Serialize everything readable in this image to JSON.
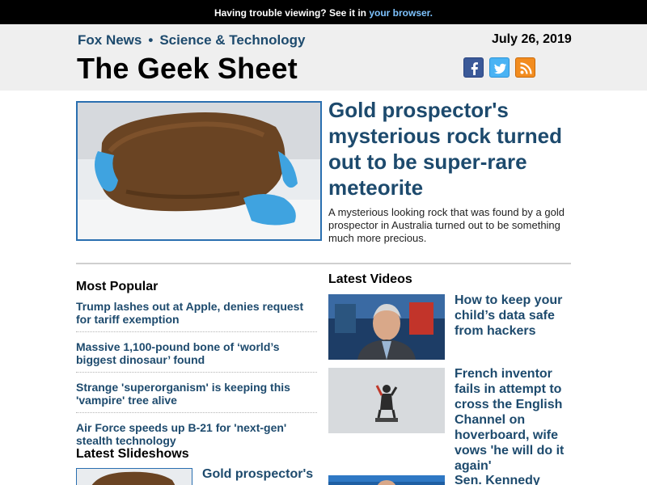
{
  "banner": {
    "text": "Having trouble viewing? See it in ",
    "link": "your browser."
  },
  "header": {
    "nav": [
      "Fox News",
      "Science & Technology"
    ],
    "separator": "•",
    "date": "July 26, 2019",
    "brand": "The Geek Sheet",
    "social": [
      "facebook-icon",
      "twitter-icon",
      "rss-icon"
    ]
  },
  "hero": {
    "title": "Gold prospector's mysterious rock turned out to be super-rare meteorite",
    "description": "A mysterious looking rock that was found by a gold prospector in Australia turned out to be something much more precious."
  },
  "most_popular": {
    "heading": "Most Popular",
    "items": [
      "Trump lashes out at Apple, denies request for tariff exemption",
      "Massive 1,100-pound bone of ‘world’s biggest dinosaur’ found",
      "Strange 'superorganism' is keeping this 'vampire' tree alive",
      "Air Force speeds up B-21 for 'next-gen' stealth technology"
    ]
  },
  "latest_videos": {
    "heading": "Latest Videos",
    "items": [
      "How to keep your child’s data safe from hackers",
      "French inventor fails in attempt to cross the English Channel on hoverboard, wife vows 'he will do it again'",
      "Sen. Kennedy"
    ]
  },
  "latest_slideshows": {
    "heading": "Latest Slideshows",
    "items": [
      "Gold prospector's"
    ]
  },
  "colors": {
    "link": "#1d4a6d",
    "banner_link": "#7ec3ff",
    "header_bg": "#efefef"
  }
}
